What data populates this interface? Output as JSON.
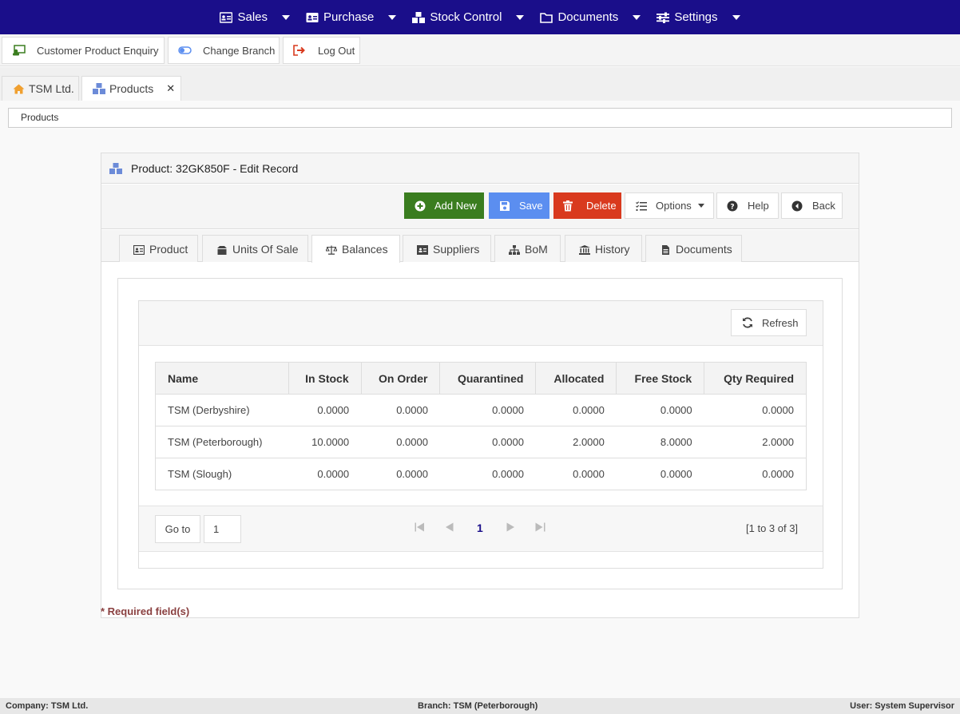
{
  "nav": {
    "items": [
      {
        "label": "Sales",
        "icon": "id-card-icon"
      },
      {
        "label": "Purchase",
        "icon": "id-card-icon"
      },
      {
        "label": "Stock Control",
        "icon": "boxes-icon"
      },
      {
        "label": "Documents",
        "icon": "folder-icon"
      },
      {
        "label": "Settings",
        "icon": "sliders-icon"
      }
    ]
  },
  "toolbar": {
    "customer_enquiry": "Customer Product Enquiry",
    "change_branch": "Change Branch",
    "log_out": "Log Out"
  },
  "page_tabs": {
    "home": "TSM Ltd.",
    "products": "Products",
    "close_symbol": "✕"
  },
  "breadcrumb": "Products",
  "panel": {
    "title": "Product: 32GK850F - Edit Record",
    "actions": {
      "add_new": "Add New",
      "save": "Save",
      "delete": "Delete",
      "options": "Options",
      "help": "Help",
      "back": "Back"
    },
    "tabs": [
      "Product",
      "Units Of Sale",
      "Balances",
      "Suppliers",
      "BoM",
      "History",
      "Documents"
    ],
    "active_tab": "Balances"
  },
  "grid": {
    "refresh": "Refresh",
    "columns": [
      "Name",
      "In Stock",
      "On Order",
      "Quarantined",
      "Allocated",
      "Free Stock",
      "Qty Required"
    ],
    "rows": [
      [
        "TSM (Derbyshire)",
        "0.0000",
        "0.0000",
        "0.0000",
        "0.0000",
        "0.0000",
        "0.0000"
      ],
      [
        "TSM (Peterborough)",
        "10.0000",
        "0.0000",
        "0.0000",
        "2.0000",
        "8.0000",
        "2.0000"
      ],
      [
        "TSM (Slough)",
        "0.0000",
        "0.0000",
        "0.0000",
        "0.0000",
        "0.0000",
        "0.0000"
      ]
    ],
    "pager": {
      "goto_label": "Go to",
      "goto_value": "1",
      "current_page": "1",
      "info": "[1 to 3 of 3]"
    }
  },
  "required_note": "* Required field(s)",
  "status": {
    "company": "Company: TSM Ltd.",
    "branch": "Branch: TSM (Peterborough)",
    "user": "User: System Supervisor"
  },
  "colors": {
    "nav_bg": "#1a0e8a",
    "add_new": "#3a7d1f",
    "save": "#5b8ef0",
    "delete": "#d93a1e"
  }
}
